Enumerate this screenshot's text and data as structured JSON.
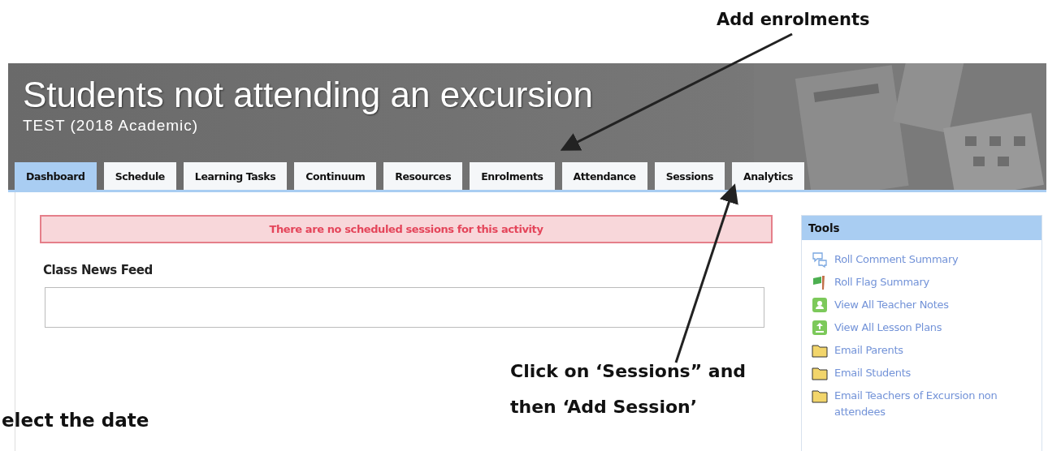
{
  "annotations": [
    {
      "text": "Add enrolments",
      "kind": "top"
    },
    {
      "text": "Click on ‘Sessions” and then ‘Add Session’",
      "kind": "middle"
    },
    {
      "text": "elect the date",
      "kind": "bottom"
    }
  ],
  "header": {
    "title": "Students not attending an excursion",
    "subtitle": "TEST (2018 Academic)"
  },
  "tabs": [
    {
      "label": "Dashboard",
      "selected": true
    },
    {
      "label": "Schedule",
      "selected": false
    },
    {
      "label": "Learning Tasks",
      "selected": false
    },
    {
      "label": "Continuum",
      "selected": false
    },
    {
      "label": "Resources",
      "selected": false
    },
    {
      "label": "Enrolments",
      "selected": false
    },
    {
      "label": "Attendance",
      "selected": false
    },
    {
      "label": "Sessions",
      "selected": false
    },
    {
      "label": "Analytics",
      "selected": false
    }
  ],
  "alert": "There are no scheduled sessions for this activity",
  "news_feed": {
    "heading": "Class News Feed"
  },
  "tools": {
    "heading": "Tools",
    "items": [
      {
        "label": "Roll Comment Summary",
        "kind": "comment"
      },
      {
        "label": "Roll Flag Summary",
        "kind": "flag"
      },
      {
        "label": "View All Teacher Notes",
        "kind": "note"
      },
      {
        "label": "View All Lesson Plans",
        "kind": "plan"
      },
      {
        "label": "Email Parents",
        "kind": "email"
      },
      {
        "label": "Email Students",
        "kind": "email"
      },
      {
        "label": "Email Teachers of Excursion non attendees",
        "kind": "email"
      }
    ]
  }
}
